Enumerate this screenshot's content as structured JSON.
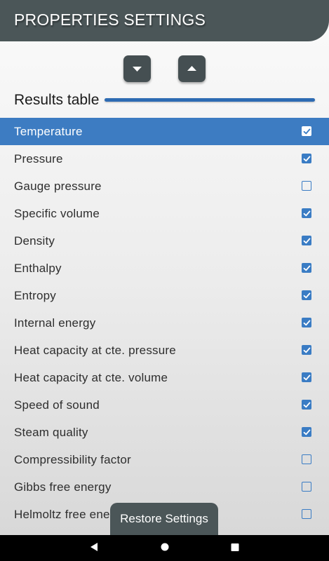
{
  "header": {
    "title": "PROPERTIES SETTINGS"
  },
  "controls": {
    "move_down_icon": "triangle-down-icon",
    "move_up_icon": "triangle-up-icon"
  },
  "section": {
    "title": "Results table"
  },
  "properties": [
    {
      "label": "Temperature",
      "checked": true,
      "selected": true
    },
    {
      "label": "Pressure",
      "checked": true,
      "selected": false
    },
    {
      "label": "Gauge pressure",
      "checked": false,
      "selected": false
    },
    {
      "label": "Specific volume",
      "checked": true,
      "selected": false
    },
    {
      "label": "Density",
      "checked": true,
      "selected": false
    },
    {
      "label": "Enthalpy",
      "checked": true,
      "selected": false
    },
    {
      "label": "Entropy",
      "checked": true,
      "selected": false
    },
    {
      "label": "Internal energy",
      "checked": true,
      "selected": false
    },
    {
      "label": "Heat capacity at cte. pressure",
      "checked": true,
      "selected": false
    },
    {
      "label": "Heat capacity at cte. volume",
      "checked": true,
      "selected": false
    },
    {
      "label": "Speed of sound",
      "checked": true,
      "selected": false
    },
    {
      "label": "Steam quality",
      "checked": true,
      "selected": false
    },
    {
      "label": "Compressibility factor",
      "checked": false,
      "selected": false
    },
    {
      "label": "Gibbs free energy",
      "checked": false,
      "selected": false
    },
    {
      "label": "Helmoltz free energy",
      "checked": false,
      "selected": false
    }
  ],
  "toast": {
    "label": "Restore Settings"
  },
  "navbar": {
    "back_icon": "back-triangle-icon",
    "home_icon": "home-circle-icon",
    "recents_icon": "recents-square-icon"
  },
  "colors": {
    "header_bg": "#4b5658",
    "accent": "#3d7cc2",
    "checkbox": "#3a7cc4"
  }
}
